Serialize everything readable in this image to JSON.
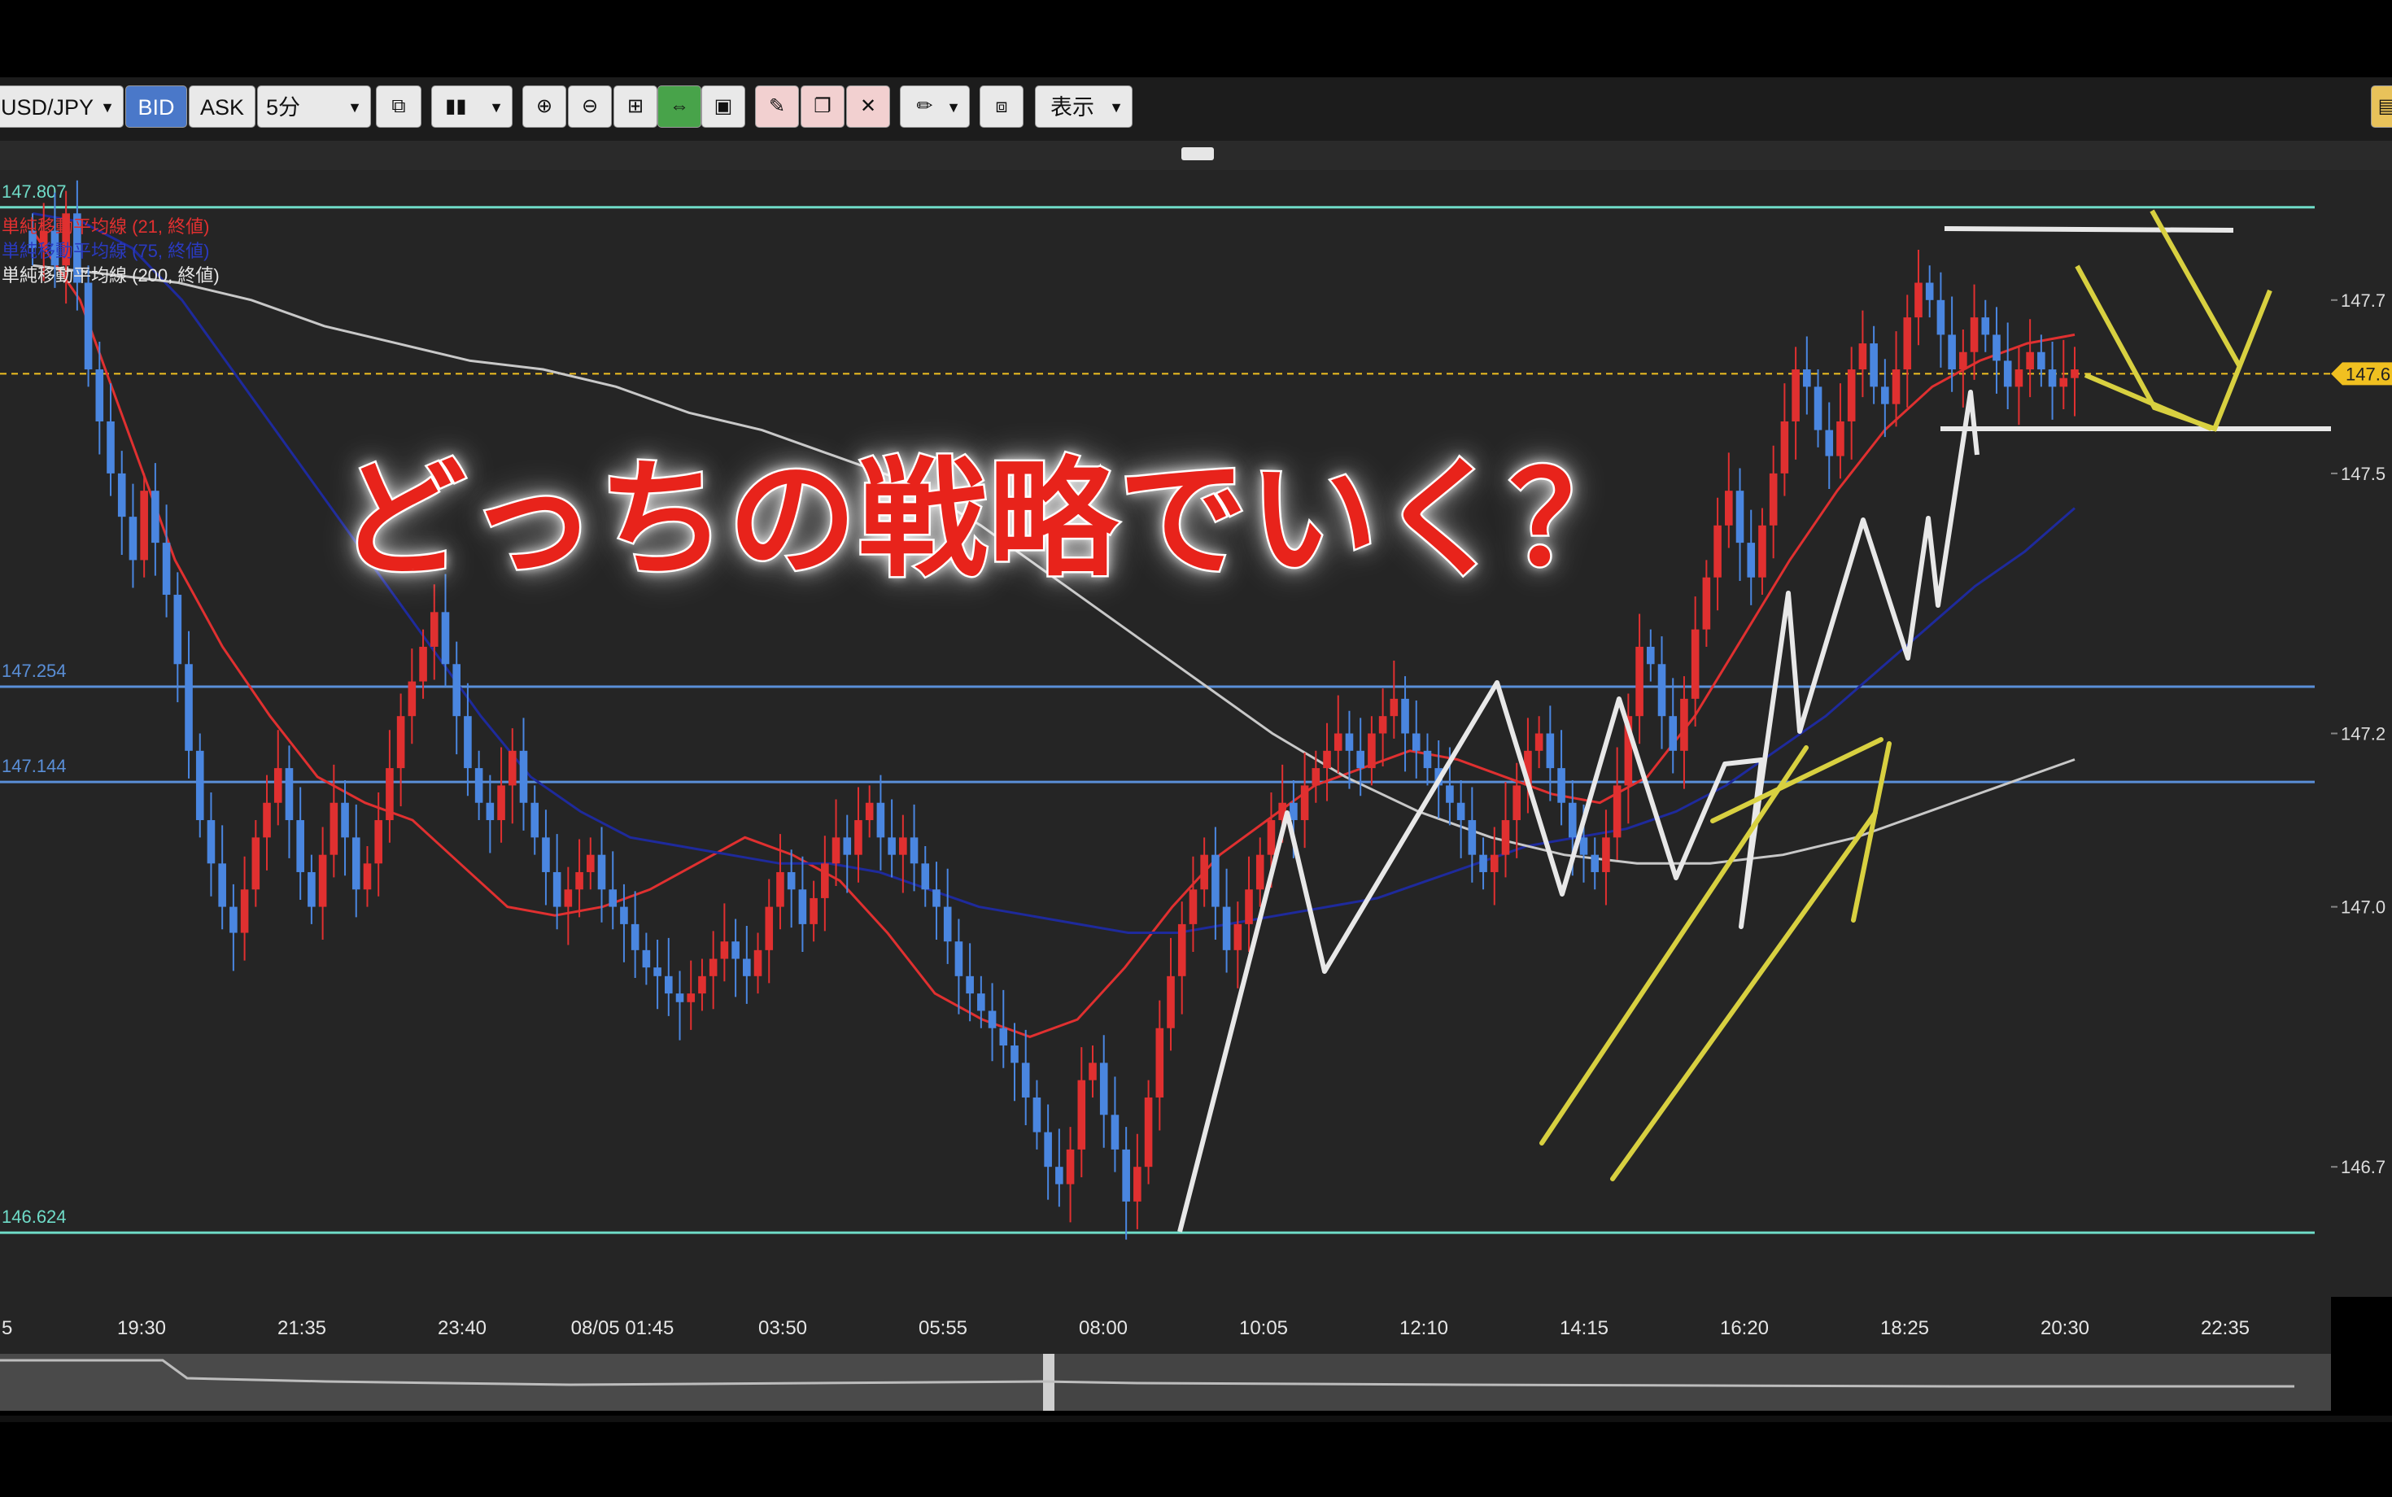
{
  "toolbar": {
    "symbol": "USD/JPY",
    "bid_label": "BID",
    "ask_label": "ASK",
    "timeframe": "5分",
    "display_label": "表示",
    "icons": [
      "copy-icon",
      "candle-type-icon",
      "zoom-in-icon",
      "zoom-out-icon",
      "fit-icon",
      "scroll-icon",
      "window-icon",
      "draw-add-icon",
      "draw-copy-icon",
      "draw-delete-icon",
      "pen-icon",
      "screenshot-icon"
    ]
  },
  "overlay_title": "どっちの戦略でいく？",
  "legend": {
    "ma21": "単純移動平均線 (21, 終値)",
    "ma75": "単純移動平均線 (75, 終値)",
    "ma200": "単純移動平均線 (200, 終値)"
  },
  "price_lines": [
    {
      "label": "147.807",
      "value": 147.807,
      "color": "#6fdcc8"
    },
    {
      "label": "147.254",
      "value": 147.254,
      "color": "#5a8fd8"
    },
    {
      "label": "147.144",
      "value": 147.144,
      "color": "#5a8fd8"
    },
    {
      "label": "146.624",
      "value": 146.624,
      "color": "#6fdcc8"
    }
  ],
  "current_price": {
    "label": "147.6",
    "value": 147.615,
    "color": "#f0c020"
  },
  "colors": {
    "up": "#e03030",
    "down": "#4a86e0",
    "ma21": "#e03030",
    "ma75": "#1e2a9c",
    "ma200": "#c8c8c8",
    "annotation_white": "#e8e8e8",
    "annotation_yellow": "#d8d040"
  },
  "chart_data": {
    "type": "line",
    "title": "",
    "xlabel": "",
    "ylabel": "",
    "x_ticks": [
      "5",
      "19:30",
      "21:35",
      "23:40",
      "08/05 01:45",
      "03:50",
      "05:55",
      "08:00",
      "10:05",
      "12:10",
      "14:15",
      "16:20",
      "18:25",
      "20:30",
      "22:35"
    ],
    "y_ticks": [
      "147.7",
      "147.5",
      "147.2",
      "147.0",
      "146.7"
    ],
    "ylim": [
      146.55,
      147.85
    ],
    "series": [
      {
        "name": "単純移動平均線 (21, 終値)",
        "values": [
          147.78,
          147.7,
          147.55,
          147.4,
          147.3,
          147.22,
          147.15,
          147.12,
          147.1,
          147.05,
          147.0,
          146.99,
          147.0,
          147.02,
          147.05,
          147.08,
          147.06,
          147.03,
          146.97,
          146.9,
          146.87,
          146.85,
          146.87,
          146.93,
          147.0,
          147.06,
          147.1,
          147.14,
          147.16,
          147.18,
          147.17,
          147.15,
          147.13,
          147.12,
          147.15,
          147.22,
          147.31,
          147.4,
          147.48,
          147.55,
          147.6,
          147.63,
          147.65,
          147.66
        ]
      },
      {
        "name": "単純移動平均線 (75, 終値)",
        "values": [
          147.8,
          147.79,
          147.76,
          147.7,
          147.62,
          147.54,
          147.46,
          147.38,
          147.3,
          147.22,
          147.15,
          147.11,
          147.08,
          147.07,
          147.06,
          147.05,
          147.05,
          147.04,
          147.02,
          147.0,
          146.99,
          146.98,
          146.97,
          146.97,
          146.98,
          146.99,
          147.0,
          147.01,
          147.03,
          147.05,
          147.07,
          147.08,
          147.09,
          147.11,
          147.14,
          147.18,
          147.22,
          147.27,
          147.32,
          147.37,
          147.41,
          147.46
        ]
      },
      {
        "name": "単純移動平均線 (200, 終値)",
        "values": [
          147.74,
          147.73,
          147.72,
          147.7,
          147.67,
          147.65,
          147.63,
          147.62,
          147.6,
          147.57,
          147.55,
          147.52,
          147.49,
          147.44,
          147.38,
          147.32,
          147.26,
          147.2,
          147.15,
          147.11,
          147.08,
          147.06,
          147.05,
          147.05,
          147.06,
          147.08,
          147.11,
          147.14,
          147.17
        ]
      }
    ],
    "candles_close": [
      147.76,
      147.78,
      147.74,
      147.8,
      147.72,
      147.62,
      147.56,
      147.5,
      147.45,
      147.4,
      147.48,
      147.42,
      147.36,
      147.28,
      147.18,
      147.1,
      147.05,
      147.0,
      146.97,
      147.02,
      147.08,
      147.12,
      147.16,
      147.1,
      147.04,
      147.0,
      147.06,
      147.12,
      147.08,
      147.02,
      147.05,
      147.1,
      147.16,
      147.22,
      147.26,
      147.3,
      147.34,
      147.28,
      147.22,
      147.16,
      147.12,
      147.1,
      147.14,
      147.18,
      147.12,
      147.08,
      147.04,
      147.0,
      147.02,
      147.04,
      147.06,
      147.02,
      147.0,
      146.98,
      146.95,
      146.93,
      146.92,
      146.9,
      146.89,
      146.9,
      146.92,
      146.94,
      146.96,
      146.94,
      146.92,
      146.95,
      147.0,
      147.04,
      147.02,
      146.98,
      147.01,
      147.05,
      147.08,
      147.06,
      147.1,
      147.12,
      147.08,
      147.06,
      147.08,
      147.05,
      147.02,
      147.0,
      146.96,
      146.92,
      146.9,
      146.88,
      146.86,
      146.84,
      146.82,
      146.78,
      146.74,
      146.7,
      146.68,
      146.72,
      146.8,
      146.82,
      146.76,
      146.72,
      146.66,
      146.7,
      146.78,
      146.86,
      146.92,
      146.98,
      147.02,
      147.06,
      147.0,
      146.95,
      146.98,
      147.02,
      147.06,
      147.1,
      147.12,
      147.1,
      147.14,
      147.16,
      147.18,
      147.2,
      147.18,
      147.16,
      147.2,
      147.22,
      147.24,
      147.2,
      147.18,
      147.16,
      147.14,
      147.12,
      147.1,
      147.06,
      147.04,
      147.06,
      147.1,
      147.14,
      147.18,
      147.2,
      147.16,
      147.12,
      147.08,
      147.06,
      147.04,
      147.08,
      147.14,
      147.22,
      147.3,
      147.28,
      147.22,
      147.18,
      147.24,
      147.32,
      147.38,
      147.44,
      147.48,
      147.42,
      147.38,
      147.44,
      147.5,
      147.56,
      147.62,
      147.6,
      147.55,
      147.52,
      147.56,
      147.62,
      147.65,
      147.6,
      147.58,
      147.62,
      147.68,
      147.72,
      147.7,
      147.66,
      147.62,
      147.64,
      147.68,
      147.66,
      147.63,
      147.6,
      147.62,
      147.64,
      147.62,
      147.6,
      147.61,
      147.62
    ]
  }
}
